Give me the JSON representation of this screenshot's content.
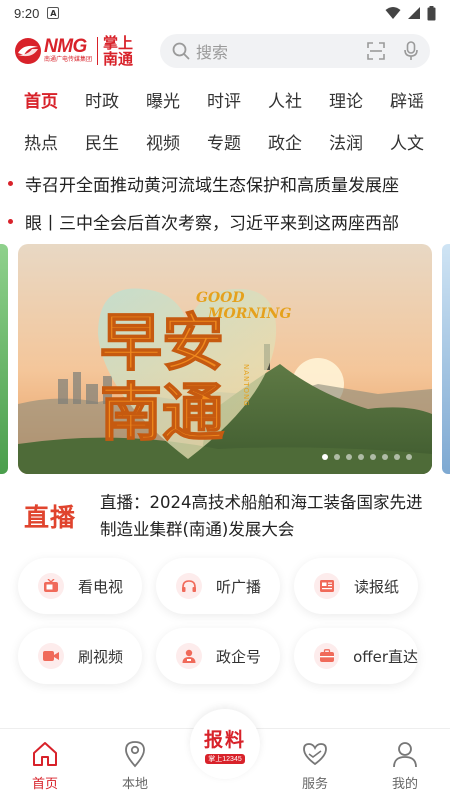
{
  "status_bar": {
    "time": "9:20",
    "notification_letter": "A"
  },
  "header": {
    "logo": {
      "brand": "NMG",
      "subtitle": "南通广电传媒集团",
      "name_line1": "掌上",
      "name_line2": "南通"
    },
    "search": {
      "placeholder": "搜索"
    }
  },
  "nav": {
    "row1": [
      "首页",
      "时政",
      "曝光",
      "时评",
      "人社",
      "理论",
      "辟谣"
    ],
    "row2": [
      "热点",
      "民生",
      "视频",
      "专题",
      "政企",
      "法润",
      "人文"
    ],
    "active": "首页"
  },
  "headlines": [
    "寺召开全面推动黄河流域生态保护和高质量发展座",
    "眼丨三中全会后首次考察，习近平来到这两座西部"
  ],
  "banner": {
    "en_line1": "GOOD",
    "en_line2": "MORNING",
    "cn_line1": "早安",
    "cn_line2": "南通",
    "vertical_en": "NANTONG",
    "dot_count": 8,
    "active_dot": 0
  },
  "live": {
    "tag": "直播",
    "text": "直播：2024高技术船舶和海工装备国家先进制造业集群(南通)发展大会"
  },
  "services": [
    {
      "label": "看电视",
      "icon": "tv-icon"
    },
    {
      "label": "听广播",
      "icon": "headphones-icon"
    },
    {
      "label": "读报纸",
      "icon": "newspaper-icon"
    },
    {
      "label": "刷视频",
      "icon": "video-camera-icon"
    },
    {
      "label": "政企号",
      "icon": "person-badge-icon"
    },
    {
      "label": "offer直达",
      "icon": "briefcase-icon"
    }
  ],
  "tabbar": {
    "items": [
      {
        "label": "首页",
        "icon": "home-icon"
      },
      {
        "label": "本地",
        "icon": "location-pin-icon"
      },
      {
        "label": "",
        "icon": "report-icon"
      },
      {
        "label": "服务",
        "icon": "heart-hands-icon"
      },
      {
        "label": "我的",
        "icon": "user-icon"
      }
    ],
    "report_label": "报料",
    "report_sub": "掌上12345",
    "active": "首页"
  },
  "colors": {
    "brand": "#d8222a",
    "live_tag": "#e0442e",
    "search_bg": "#f1f2f4"
  }
}
